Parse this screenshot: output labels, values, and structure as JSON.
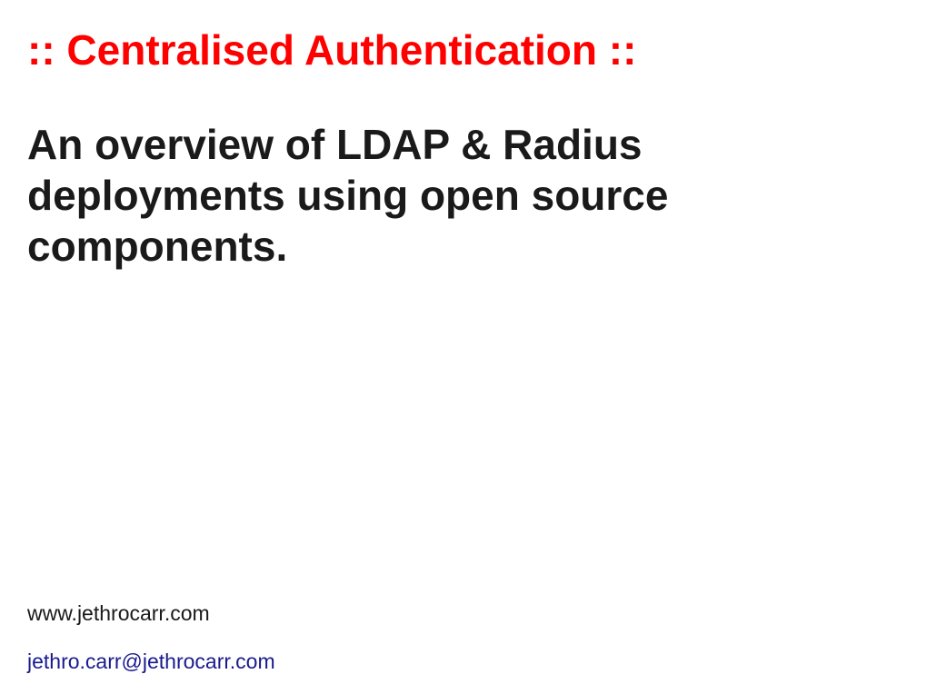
{
  "slide": {
    "title": ":: Centralised Authentication ::",
    "subtitle": "An overview of LDAP & Radius deployments using open source components."
  },
  "footer": {
    "website": "www.jethrocarr.com",
    "email": "jethro.carr@jethrocarr.com"
  }
}
